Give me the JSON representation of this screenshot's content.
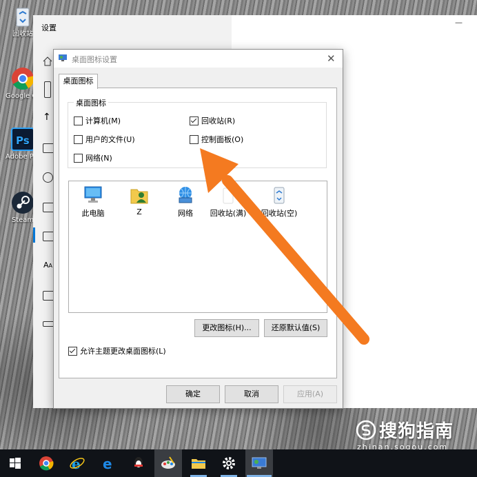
{
  "desktop": {
    "icons": [
      {
        "label": "回收站",
        "icon": "recycle-bin-icon"
      },
      {
        "label": "Google Chrome",
        "icon": "chrome-icon"
      },
      {
        "label": "Adobe Photoshop",
        "icon": "photoshop-icon"
      },
      {
        "label": "Steam",
        "icon": "steam-icon"
      }
    ]
  },
  "settings_window": {
    "title": "设置",
    "minimize_glyph": "—"
  },
  "dialog": {
    "title": "桌面图标设置",
    "close_glyph": "✕",
    "tab_label": "桌面图标",
    "group_label": "桌面图标",
    "checkboxes": [
      {
        "label": "计算机(M)",
        "checked": false
      },
      {
        "label": "回收站(R)",
        "checked": true
      },
      {
        "label": "用户的文件(U)",
        "checked": false
      },
      {
        "label": "控制面板(O)",
        "checked": false
      },
      {
        "label": "网络(N)",
        "checked": false
      }
    ],
    "icon_list": [
      {
        "label": "此电脑",
        "icon": "computer-icon"
      },
      {
        "label": "Z",
        "icon": "user-folder-icon"
      },
      {
        "label": "网络",
        "icon": "network-icon"
      },
      {
        "label": "回收站(满)",
        "icon": "recycle-bin-full-icon"
      },
      {
        "label": "回收站(空)",
        "icon": "recycle-bin-empty-icon"
      }
    ],
    "change_icon_label": "更改图标(H)...",
    "restore_default_label": "还原默认值(S)",
    "allow_theme": {
      "label": "允许主题更改桌面图标(L)",
      "checked": true
    },
    "ok_label": "确定",
    "cancel_label": "取消",
    "apply_label": "应用(A)"
  },
  "taskbar": {
    "items": [
      "windows-start-icon",
      "chrome-icon",
      "ie-icon",
      "edge-icon",
      "qq-icon",
      "paint-icon",
      "file-explorer-icon",
      "settings-gear-icon",
      "desktop-icon-settings-icon"
    ]
  },
  "watermark": {
    "brand": "搜狗指南",
    "url": "zhinan.sogou.com"
  },
  "colors": {
    "annotation_arrow": "#f47a20",
    "taskbar": "#101318",
    "dialog_bg": "#f0f0f0"
  }
}
